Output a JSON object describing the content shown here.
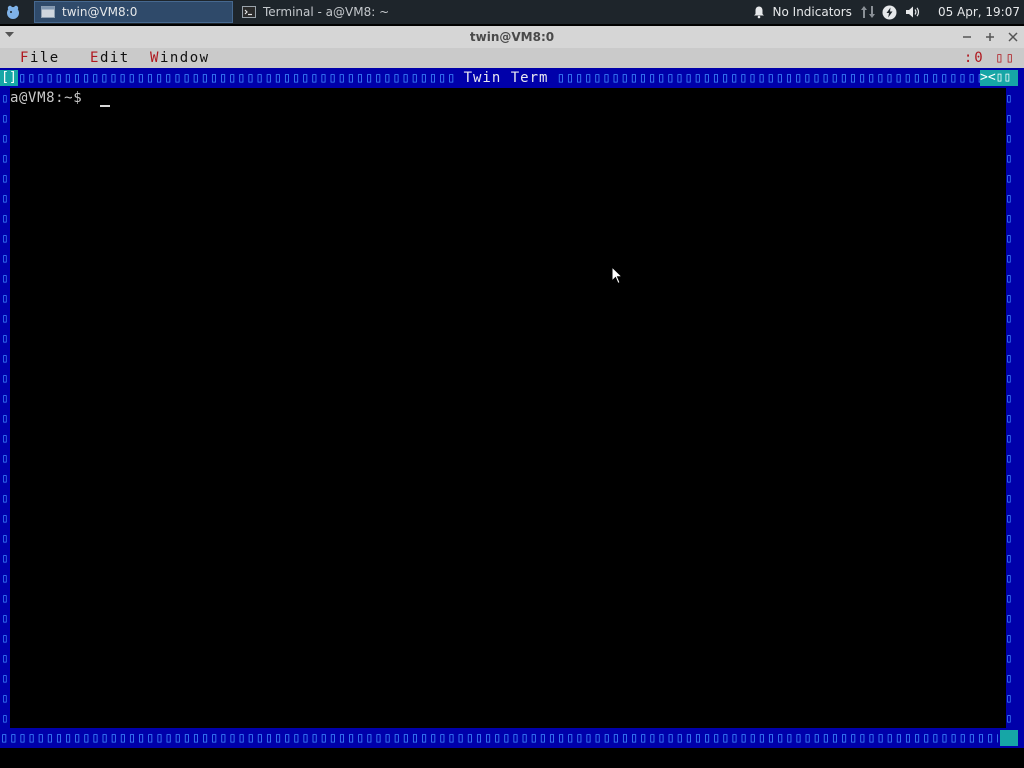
{
  "panel": {
    "app_menu_icon": "xfce-mouse-icon",
    "tasks": [
      {
        "label": "twin@VM8:0",
        "icon": "window-icon",
        "active": true
      },
      {
        "label": "Terminal - a@VM8: ~",
        "icon": "terminal-icon",
        "active": false
      }
    ],
    "indicators_label": "No Indicators",
    "clock": "05 Apr, 19:07"
  },
  "window": {
    "title": "twin@VM8:0",
    "buttons": [
      "minimize",
      "maximize",
      "close"
    ]
  },
  "twin": {
    "menu": {
      "file": {
        "hot": "F",
        "rest": "ile"
      },
      "edit": {
        "hot": "E",
        "rest": "dit"
      },
      "window": {
        "hot": "W",
        "rest": "indow"
      },
      "right_status": ":0 ▯▯"
    },
    "frame_title": "Twin Term",
    "close_gadget": "[]",
    "right_gadgets": "><▯▯",
    "frame_glyph": "▯",
    "prompt": "a@VM8:~$"
  },
  "colors": {
    "panel_bg": "#1e252b",
    "titlebar_bg": "#d6d6d6",
    "twin_menu_bg": "#cacaca",
    "twin_frame": "#0000aa",
    "twin_gadget": "#16a6a6",
    "hotkey_red": "#b0181f"
  }
}
